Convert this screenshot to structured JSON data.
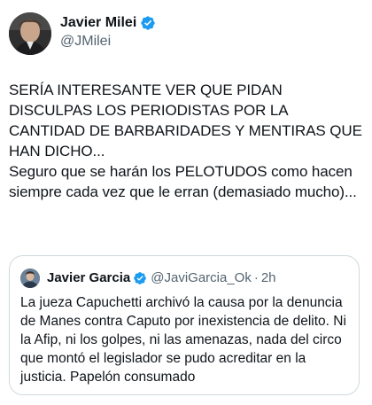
{
  "author": {
    "name": "Javier Milei",
    "handle": "@JMilei",
    "avatar_icon": "profile-photo"
  },
  "tweet": {
    "text": "SERÍA INTERESANTE VER QUE PIDAN DISCULPAS LOS PERIODISTAS POR LA CANTIDAD DE BARBARIDADES Y MENTIRAS QUE HAN DICHO...\nSeguro que se harán los PELOTUDOS como hacen siempre cada vez que le erran (demasiado mucho)..."
  },
  "quoted": {
    "name": "Javier Garcia",
    "handle": "@JaviGarcia_Ok",
    "separator": "·",
    "time": "2h",
    "text": "La jueza Capuchetti archivó la causa por la denuncia de Manes contra Caputo por inexistencia de delito. Ni la Afip, ni los golpes, ni las amenazas, nada del circo que montó el legislador se pudo acreditar en la justicia. Papelón consumado"
  },
  "colors": {
    "verified_badge": "#1d9bf0",
    "secondary_text": "#536471",
    "border": "#cfd9de"
  }
}
